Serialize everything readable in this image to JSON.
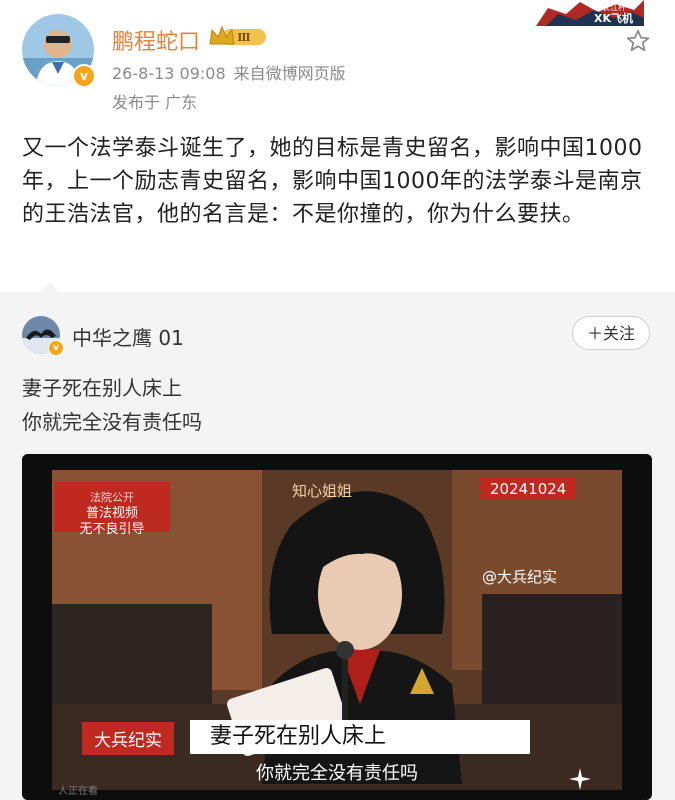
{
  "post": {
    "username": "鹏程蛇口",
    "verified_badge": "v",
    "level_badge": "Ⅲ",
    "timestamp": "26-8-13 09:08",
    "source": "来自微博网页版",
    "location": "发布于 广东",
    "corner_logo_top": "长江杯",
    "corner_logo_bottom": "XK飞机",
    "body": "又一个法学泰斗诞生了，她的目标是青史留名，影响中国1000年，上一个励志青史留名，影响中国1000年的法学泰斗是南京的王浩法官，他的名言是：不是你撞的，你为什么要扶。",
    "favorite_icon": "star-icon"
  },
  "repost": {
    "username": "中华之鹰 01",
    "verified_badge": "v",
    "follow_label": "＋关注",
    "line1": "妻子死在别人床上",
    "line2": "你就完全没有责任吗",
    "video": {
      "tag_top_small": "法院公开",
      "tag_line1": "普法视频",
      "tag_line2": "无不良引导",
      "zhixin": "知心姐姐",
      "date": "20241024",
      "watermark": "@大兵纪实",
      "brand": "大兵纪实",
      "subtitle1": "妻子死在别人床上",
      "subtitle2": "你就完全没有责任吗",
      "corner_text": "人正在看"
    }
  },
  "colors": {
    "username_orange": "#e8823a",
    "meta_gray": "#8a8a8a",
    "repost_bg": "#f4f4f4",
    "brand_red": "#c0291f",
    "badge_gold": "#f7a41d"
  }
}
